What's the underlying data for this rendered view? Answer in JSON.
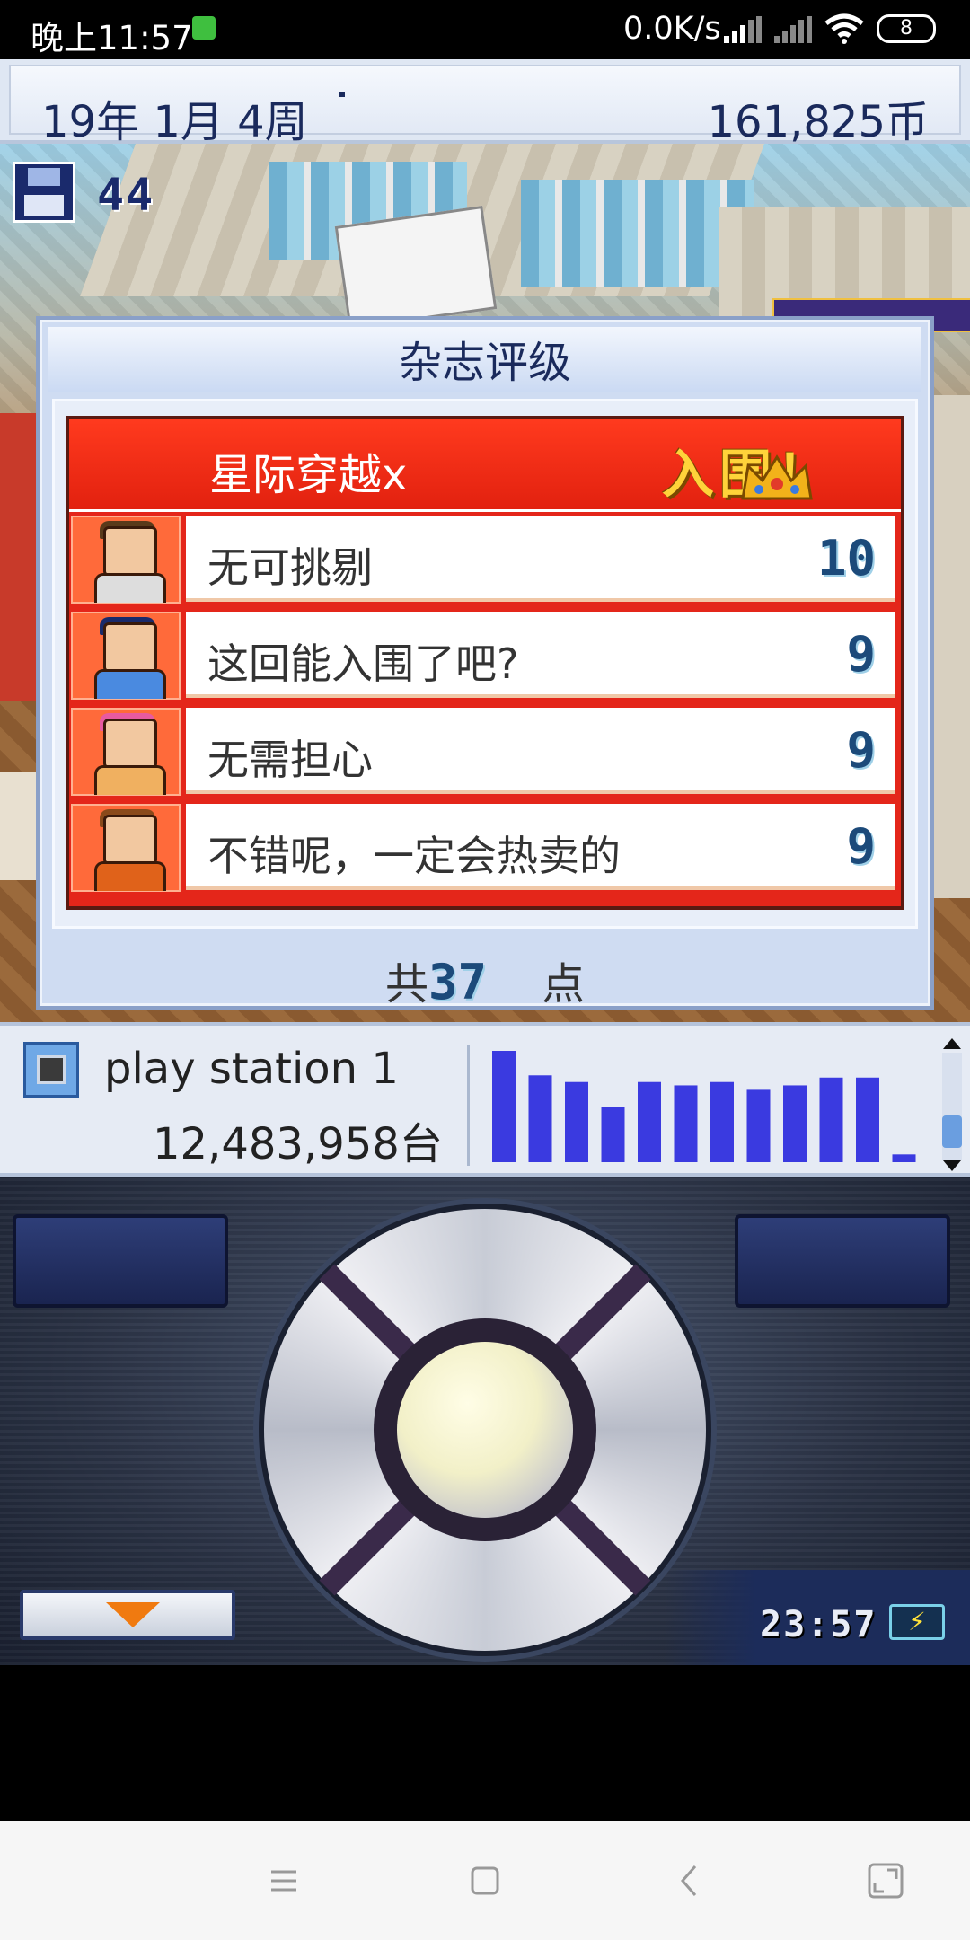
{
  "status_bar": {
    "time": "晚上11:57",
    "net_speed": "0.0K/s",
    "battery": "8"
  },
  "info_bar": {
    "date": "19年 1月 4周",
    "money": "161,825币"
  },
  "scene": {
    "save_count": "44"
  },
  "dialog": {
    "title": "杂志评级",
    "game_name": "星际穿越x",
    "nominated_label": "入围！",
    "reviews": [
      {
        "comment": "无可挑剔",
        "score": "10"
      },
      {
        "comment": "这回能入围了吧?",
        "score": "9"
      },
      {
        "comment": "无需担心",
        "score": "9"
      },
      {
        "comment": "不错呢，一定会热卖的",
        "score": "9"
      }
    ],
    "total_prefix": "共",
    "total_value": "37",
    "total_suffix": "点"
  },
  "console": {
    "name": "play station 1",
    "sales": "12,483,958台",
    "sales_history": [
      1.0,
      0.78,
      0.72,
      0.5,
      0.72,
      0.69,
      0.72,
      0.65,
      0.69,
      0.76,
      0.76,
      0.07
    ]
  },
  "controller": {
    "clock": "23:57"
  },
  "colors": {
    "accent_red": "#e4261a",
    "score_blue": "#1c4a7a",
    "bar_blue": "#3a3ae0",
    "nominated_yellow": "#ffd33a"
  }
}
